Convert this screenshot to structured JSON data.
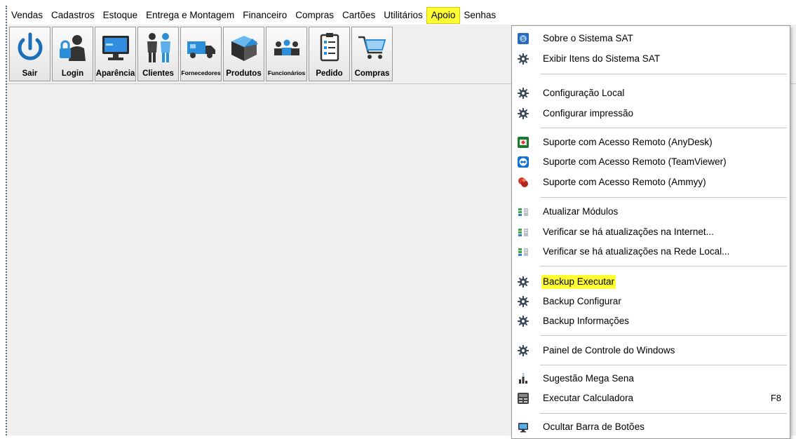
{
  "menubar": {
    "items": [
      "Vendas",
      "Cadastros",
      "Estoque",
      "Entrega e Montagem",
      "Financeiro",
      "Compras",
      "Cartões",
      "Utilitários",
      "Apoio",
      "Senhas"
    ],
    "active": "Apoio"
  },
  "toolbar": {
    "buttons": [
      {
        "label": "Sair",
        "icon": "power-icon"
      },
      {
        "label": "Login",
        "icon": "login-lock-user-icon"
      },
      {
        "label": "Aparência",
        "icon": "monitor-icon"
      },
      {
        "label": "Clientes",
        "icon": "clients-people-icon"
      },
      {
        "label": "Fornecedores",
        "icon": "truck-icon"
      },
      {
        "label": "Produtos",
        "icon": "box-icon"
      },
      {
        "label": "Funcionários",
        "icon": "employees-group-icon"
      },
      {
        "label": "Pedido",
        "icon": "clipboard-icon"
      },
      {
        "label": "Compras",
        "icon": "shopping-cart-icon"
      }
    ]
  },
  "dropdown": {
    "items": [
      {
        "label": "Sobre o Sistema SAT",
        "icon": "sat-info-icon"
      },
      {
        "label": "Exibir Itens do Sistema SAT",
        "icon": "gear-icon"
      },
      {
        "label": "Configuração Local",
        "icon": "gear-icon"
      },
      {
        "label": "Configurar impressão",
        "icon": "gear-icon"
      },
      {
        "label": "Suporte com Acesso Remoto (AnyDesk)",
        "icon": "anydesk-icon"
      },
      {
        "label": "Suporte com Acesso Remoto (TeamViewer)",
        "icon": "teamviewer-icon"
      },
      {
        "label": "Suporte com Acesso Remoto (Ammyy)",
        "icon": "ammyy-icon"
      },
      {
        "label": "Atualizar Módulos",
        "icon": "update-icon"
      },
      {
        "label": "Verificar se há atualizações na Internet...",
        "icon": "update-icon"
      },
      {
        "label": "Verificar se há atualizações na Rede Local...",
        "icon": "update-icon"
      },
      {
        "label": "Backup Executar",
        "icon": "gear-icon",
        "highlighted": true
      },
      {
        "label": "Backup Configurar",
        "icon": "gear-icon"
      },
      {
        "label": "Backup Informações",
        "icon": "gear-icon"
      },
      {
        "label": "Painel de Controle do Windows",
        "icon": "gear-icon"
      },
      {
        "label": "Sugestão Mega Sena",
        "icon": "mega-sena-chart-icon"
      },
      {
        "label": "Executar Calculadora",
        "icon": "calculator-icon",
        "shortcut": "F8"
      },
      {
        "label": "Ocultar Barra de Botões",
        "icon": "monitor-icon"
      }
    ]
  },
  "colors": {
    "highlight": "#ffff33",
    "window_bg": "#f0f0f0",
    "menu_bg": "#ffffff"
  }
}
